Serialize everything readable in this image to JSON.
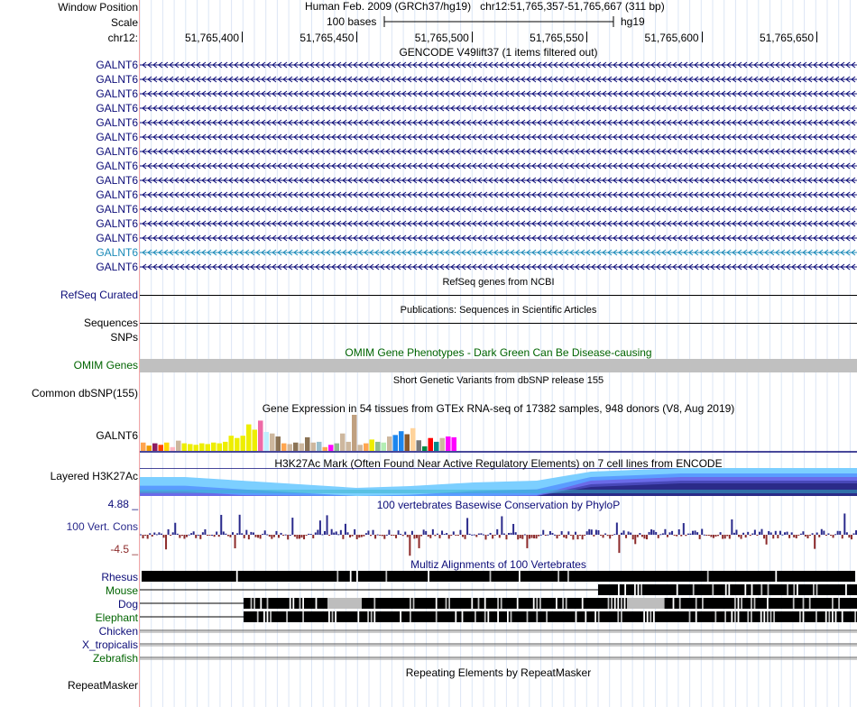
{
  "header": {
    "window_position_label": "Window Position",
    "scale_label": "Scale",
    "chrom_label": "chr12:",
    "assembly_text": "Human Feb. 2009 (GRCh37/hg19)   chr12:51,765,357-51,765,667 (311 bp)",
    "scale_text": "100 bases",
    "db_text": "hg19",
    "ruler_ticks": [
      "51,765,400",
      "51,765,450",
      "51,765,500",
      "51,765,550",
      "51,765,600",
      "51,765,650"
    ]
  },
  "gencode": {
    "title": "GENCODE V49lift37 (1 items filtered out)",
    "items": [
      "GALNT6",
      "GALNT6",
      "GALNT6",
      "GALNT6",
      "GALNT6",
      "GALNT6",
      "GALNT6",
      "GALNT6",
      "GALNT6",
      "GALNT6",
      "GALNT6",
      "GALNT6",
      "GALNT6",
      "GALNT6",
      "GALNT6"
    ],
    "highlight_index": 13,
    "color": "#0c0c78",
    "highlight_color": "#1a8ab8"
  },
  "refseq": {
    "title": "RefSeq genes from NCBI",
    "label": "RefSeq Curated"
  },
  "publications": {
    "title": "Publications: Sequences in Scientific Articles",
    "label": "Sequences",
    "snps_label": "SNPs"
  },
  "omim": {
    "title": "OMIM Gene Phenotypes - Dark Green Can Be Disease-causing",
    "label": "OMIM Genes",
    "color": "#006400"
  },
  "dbsnp": {
    "title": "Short Genetic Variants from dbSNP release 155",
    "label": "Common dbSNP(155)"
  },
  "gtex": {
    "title": "Gene Expression in 54 tissues from GTEx RNA-seq of 17382 samples, 948 donors (V8, Aug 2019)",
    "label": "GALNT6",
    "values": [
      0.22,
      0.14,
      0.2,
      0.16,
      0.22,
      0.1,
      0.27,
      0.2,
      0.18,
      0.16,
      0.2,
      0.18,
      0.22,
      0.2,
      0.24,
      0.4,
      0.34,
      0.4,
      0.7,
      0.56,
      0.8,
      0.5,
      0.46,
      0.38,
      0.2,
      0.18,
      0.22,
      0.2,
      0.36,
      0.22,
      0.24,
      0.1,
      0.16,
      0.2,
      0.46,
      0.24,
      1.0,
      0.16,
      0.2,
      0.3,
      0.24,
      0.22,
      0.38,
      0.42,
      0.52,
      0.44,
      0.6,
      0.28,
      0.12,
      0.34,
      0.24,
      0.34,
      0.38,
      0.36
    ],
    "colors": [
      "#ffa54f",
      "#ee9a00",
      "#8b1c62",
      "#ff4500",
      "#ffd700",
      "#ffb6c1",
      "#cdb79e",
      "#eeee00",
      "#eeee00",
      "#eeee00",
      "#eeee00",
      "#eeee00",
      "#eeee00",
      "#eeee00",
      "#eeee00",
      "#eeee00",
      "#eeee00",
      "#eeee00",
      "#eeee00",
      "#eeee00",
      "#ee6aa7",
      "#bfefff",
      "#cdb79e",
      "#8b7355",
      "#ffa54f",
      "#cdb79e",
      "#8b7355",
      "#cdb79e",
      "#8b7355",
      "#cdb79e",
      "#9ac0cd",
      "#ffa54f",
      "#ff00ff",
      "#8fbc8f",
      "#cdb79e",
      "#cdb79e",
      "#c0a080",
      "#cdb79e",
      "#ffa54f",
      "#eeee00",
      "#8fbc8f",
      "#b4eeb4",
      "#cdb79e",
      "#1c86ee",
      "#1c86ee",
      "#8b5a2b",
      "#ffd39b",
      "#7a7a7a",
      "#008b45",
      "#ff0000",
      "#008b8b",
      "#cdb79e",
      "#ff00ff",
      "#ff00ff"
    ]
  },
  "h3k27ac": {
    "title": "H3K27Ac Mark (Often Found Near Active Regulatory Elements) on 7 cell lines from ENCODE",
    "label": "Layered H3K27Ac"
  },
  "phylop": {
    "title": "100 vertebrates Basewise Conservation by PhyloP",
    "label": "100 Vert. Cons",
    "ymax": "4.88 _",
    "ymin": "-4.5 _",
    "pos_color": "#2a2a8c",
    "neg_color": "#8c2a2a"
  },
  "multiz": {
    "title": "Multiz Alignments of 100 Vertebrates",
    "species": [
      "Rhesus",
      "Mouse",
      "Dog",
      "Elephant",
      "Chicken",
      "X_tropicalis",
      "Zebrafish"
    ],
    "species_colors": [
      "#0c0c78",
      "#006400",
      "#0c0c78",
      "#006400",
      "#0c0c78",
      "#0c0c78",
      "#006400"
    ]
  },
  "repeatmasker": {
    "title": "Repeating Elements by RepeatMasker",
    "label": "RepeatMasker"
  }
}
